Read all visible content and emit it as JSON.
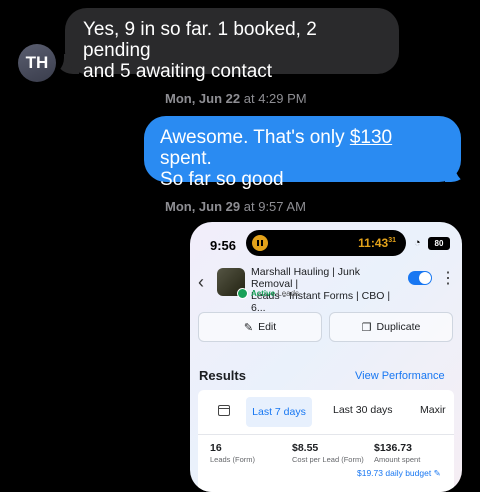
{
  "messages": [
    {
      "type": "incoming",
      "text_line1": "Yes, 9 in so far. 1 booked, 2 pending",
      "text_line2": "and 5 awaiting contact",
      "avatar": "TH"
    },
    {
      "type": "timestamp",
      "day": "Mon, Jun 22",
      "at": "at",
      "time": "4:29 PM"
    },
    {
      "type": "outgoing",
      "text_pre": "Awesome. That's only ",
      "amount": "$130",
      "text_post": " spent.",
      "text_line2": "So far so good"
    },
    {
      "type": "timestamp",
      "day": "Mon, Jun 29",
      "at": "at",
      "time": "9:57 AM"
    }
  ],
  "attachment": {
    "status_bar": {
      "time": "9:56",
      "recording_time": "11:43",
      "recording_sup": "31",
      "battery": "80",
      "icons": [
        "pause-icon",
        "wifi-icon",
        "battery-icon"
      ]
    },
    "campaign": {
      "name_line1": "Marshall Hauling | Junk Removal |",
      "name_line2": "Leads - Instant Forms | CBO | 6...",
      "status": "Active",
      "status_type": "Leads",
      "toggle_on": true
    },
    "buttons": {
      "edit": "Edit",
      "duplicate": "Duplicate"
    },
    "results": {
      "title": "Results",
      "view_performance": "View Performance",
      "tabs": [
        "Last 7 days",
        "Last 30 days",
        "Maxir"
      ],
      "active_tab": "Last 7 days",
      "metrics": [
        {
          "value": "16",
          "label": "Leads (Form)"
        },
        {
          "value": "$8.55",
          "label": "Cost per Lead (Form)"
        },
        {
          "value": "$136.73",
          "label": "Amount spent"
        }
      ],
      "budget": "$19.73 daily budget"
    }
  },
  "colors": {
    "incoming_bubble": "#2a2a2c",
    "outgoing_bubble": "#2a8bf2",
    "accent": "#1877f2",
    "active_green": "#18a058",
    "recording": "#e3a21a"
  }
}
